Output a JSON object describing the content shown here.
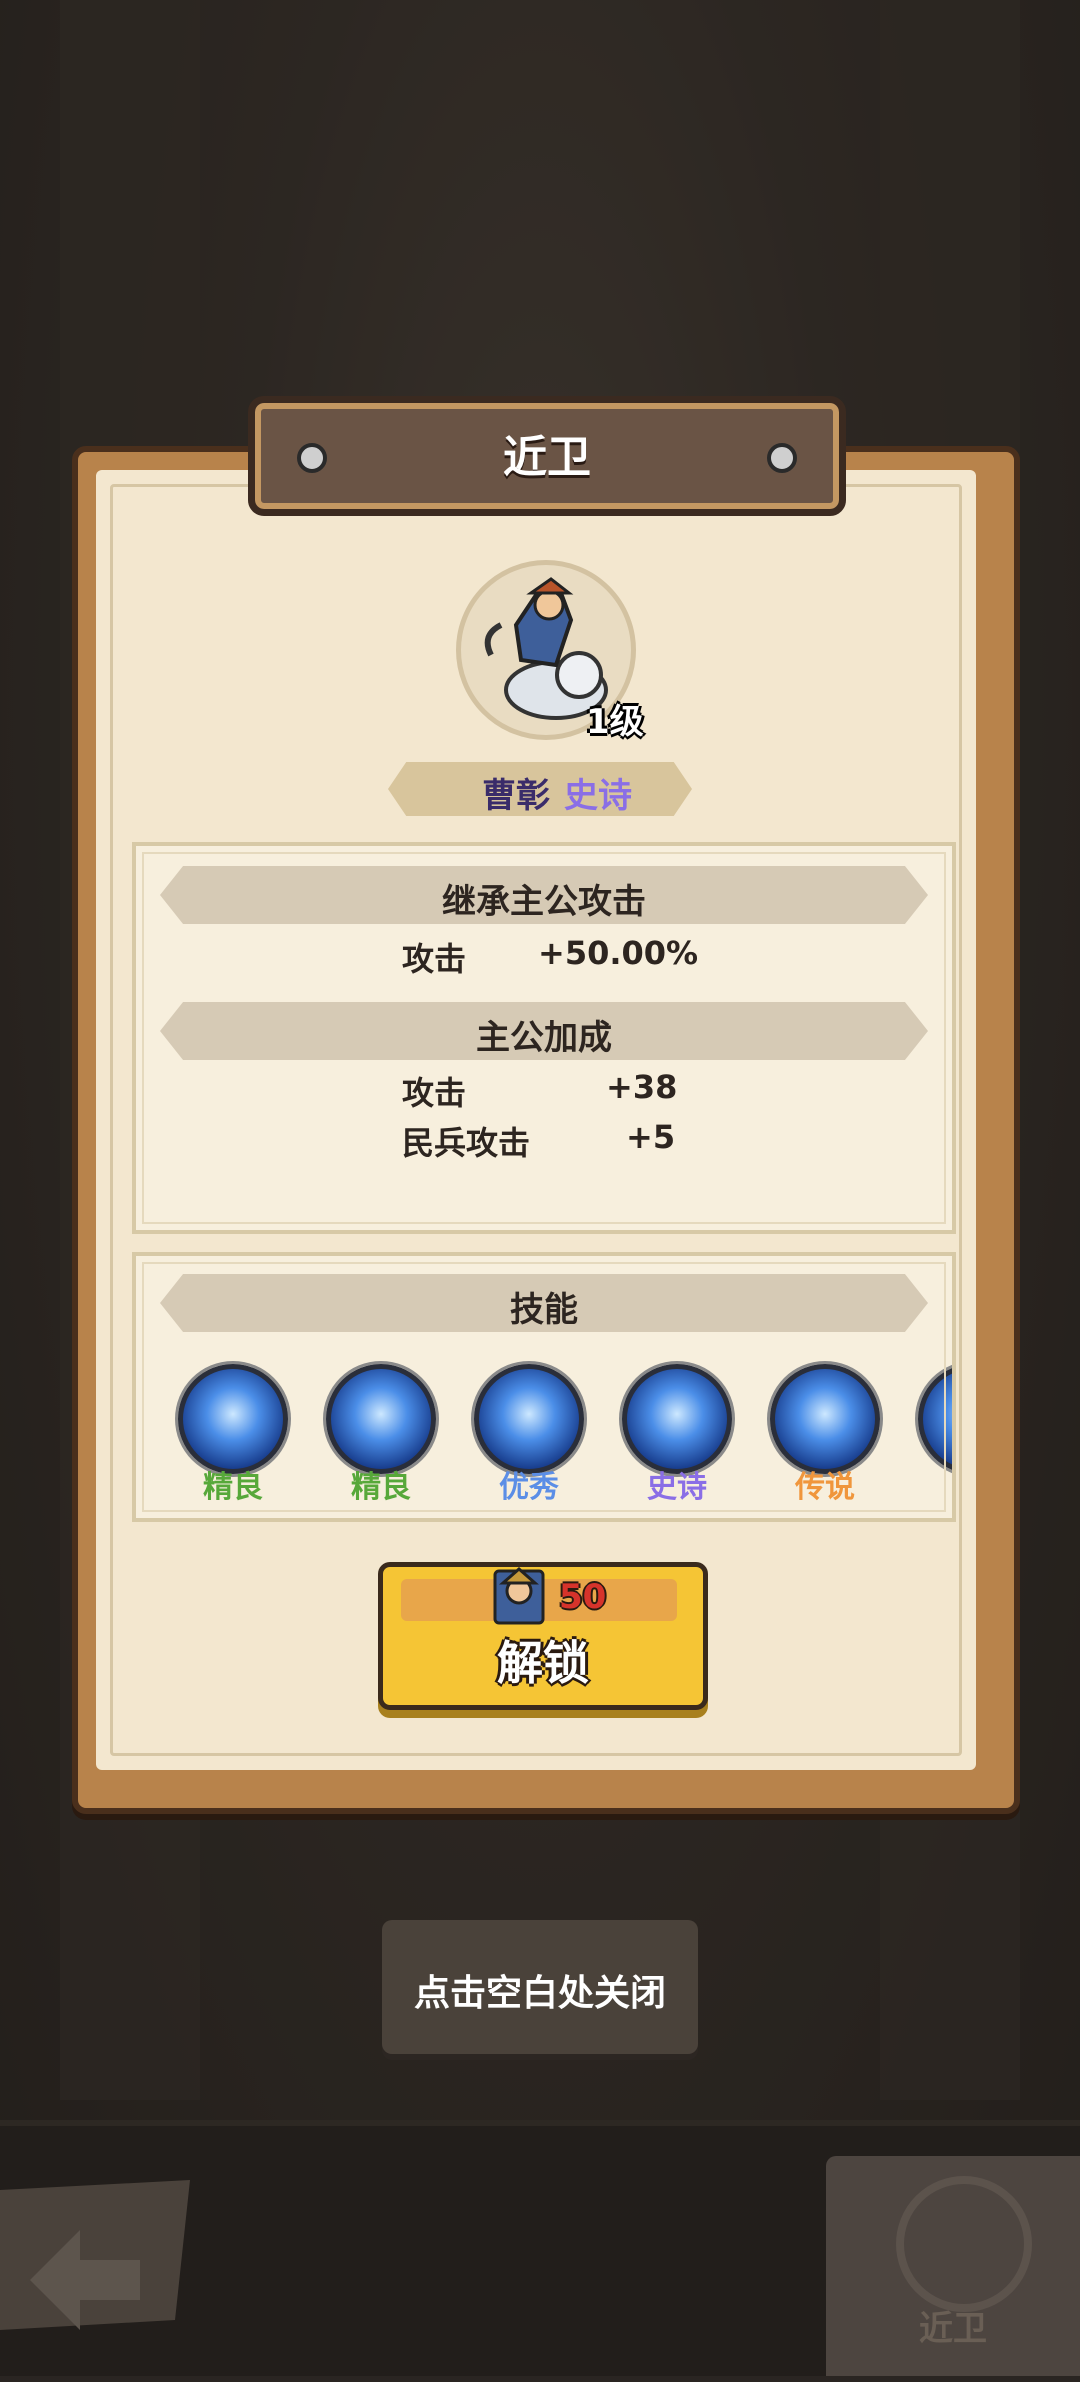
{
  "popup": {
    "title": "近卫",
    "hero": {
      "level": "1级",
      "name": "曹彰",
      "rarity": "史诗"
    },
    "inherit": {
      "header": "继承主公攻击",
      "rows": [
        {
          "label": "攻击",
          "value": "+50.00%"
        }
      ]
    },
    "bonus": {
      "header": "主公加成",
      "rows": [
        {
          "label": "攻击",
          "value": "+38"
        },
        {
          "label": "民兵攻击",
          "value": "+5"
        }
      ]
    },
    "skills": {
      "header": "技能",
      "items": [
        {
          "label": "精良",
          "color": "#57a83a",
          "icon": "skill-icon-1"
        },
        {
          "label": "精良",
          "color": "#57a83a",
          "icon": "skill-icon-2"
        },
        {
          "label": "优秀",
          "color": "#5b8ee6",
          "icon": "skill-icon-3"
        },
        {
          "label": "史诗",
          "color": "#8a6ee6",
          "icon": "skill-icon-4"
        },
        {
          "label": "传说",
          "color": "#f0963c",
          "icon": "skill-icon-5"
        }
      ]
    },
    "unlock": {
      "cost": "50",
      "label": "解锁"
    }
  },
  "close_hint": "点击空白处关闭",
  "bottom_nav": {
    "tab_label": "近卫"
  },
  "colors": {
    "panel_border": "#b8834b",
    "parchment": "#f3e7cf",
    "unlock_button": "#f5c535",
    "cost_red": "#d6332b"
  }
}
